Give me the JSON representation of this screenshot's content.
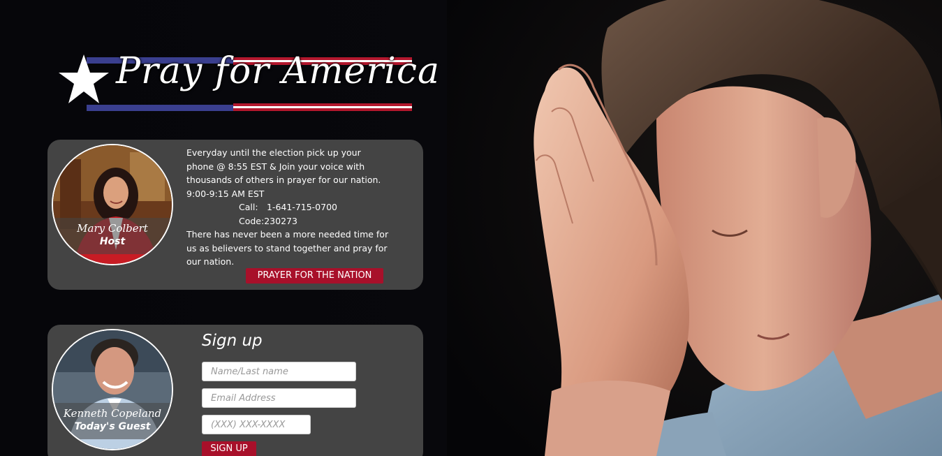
{
  "logo": {
    "text": "Pray for America",
    "icon": "star-icon",
    "colors": {
      "blue": "#3a3f8f",
      "red": "#b3172d",
      "white": "#ffffff"
    }
  },
  "host_card": {
    "portrait": {
      "name": "Mary Colbert",
      "role": "Host"
    },
    "lines": [
      "Everyday until the election pick up your",
      "phone @ 8:55 EST & Join your voice with",
      "thousands of others in prayer for our nation.",
      "9:00-9:15 AM EST"
    ],
    "call_label": "Call:",
    "call_number": "1-641-715-0700",
    "code": "Code:230273",
    "closing": [
      "There has never been a more needed time for",
      "us as believers to stand together and pray for",
      "our nation."
    ],
    "button": "PRAYER FOR THE NATION"
  },
  "signup_card": {
    "portrait": {
      "name": "Kenneth Copeland",
      "role": "Today's Guest"
    },
    "title": "Sign up",
    "fields": {
      "name_placeholder": "Name/Last name",
      "email_placeholder": "Email Address",
      "phone_placeholder": "(XXX) XXX-XXXX"
    },
    "button": "SIGN UP"
  },
  "theme": {
    "card_bg": "#444444",
    "accent_red": "#a8102a",
    "page_bg": "#06060a"
  }
}
